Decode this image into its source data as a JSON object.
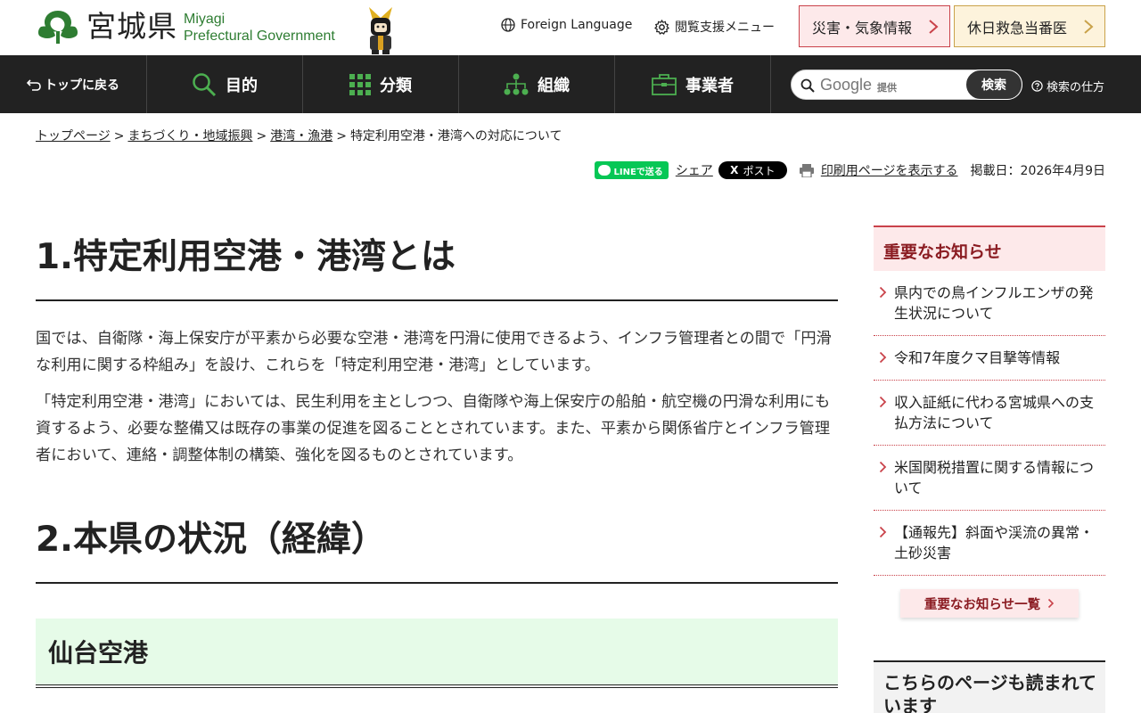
{
  "header": {
    "logo_ja": "宮城県",
    "logo_en_line1": "Miyagi",
    "logo_en_line2": "Prefectural Government",
    "foreign_language": "Foreign Language",
    "accessibility_menu": "閲覧支援メニュー",
    "disaster_button": "災害・気象情報",
    "holiday_button": "休日救急当番医"
  },
  "nav": {
    "back_to_top": "トップに戻る",
    "items": [
      {
        "label": "目的",
        "icon": "search-icon"
      },
      {
        "label": "分類",
        "icon": "grid-icon"
      },
      {
        "label": "組織",
        "icon": "org-chart-icon"
      },
      {
        "label": "事業者",
        "icon": "briefcase-icon"
      }
    ],
    "search_provider": "Google",
    "search_provider_suffix": "提供",
    "search_button": "検索",
    "search_help": "検索の仕方"
  },
  "breadcrumb": {
    "items": [
      "トップページ",
      "まちづくり・地域振興",
      "港湾・漁港"
    ],
    "current": "特定利用空港・港湾への対応について",
    "separator": ">"
  },
  "share": {
    "line": "LINEで送る",
    "facebook_share": "シェア",
    "x_post": "ポスト",
    "print": "印刷用ページを表示する",
    "posted_date": "掲載日：2026年4月9日"
  },
  "main": {
    "section1_heading": "1.特定利用空港・港湾とは",
    "section1_paragraph1": "国では、自衛隊・海上保安庁が平素から必要な空港・港湾を円滑に使用できるよう、インフラ管理者との間で「円滑な利用に関する枠組み」を設け、これらを「特定利用空港・港湾」としています。",
    "section1_paragraph2": "「特定利用空港・港湾」においては、民生利用を主としつつ、自衛隊や海上保安庁の船舶・航空機の円滑な利用にも資するよう、必要な整備又は既存の事業の促進を図ることとされています。また、平素から関係省庁とインフラ管理者において、連絡・調整体制の構築、強化を図るものとされています。",
    "section2_heading": "2.本県の状況（経緯）",
    "subsection_heading": "仙台空港"
  },
  "sidebar": {
    "important_heading": "重要なお知らせ",
    "important_items": [
      "県内での鳥インフルエンザの発生状況について",
      "令和7年度クマ目撃等情報",
      "収入証紙に代わる宮城県への支払方法について",
      "米国関税措置に関する情報について",
      "【通報先】斜面や渓流の異常・土砂災害"
    ],
    "important_more": "重要なお知らせ一覧",
    "also_read_heading": "こちらのページも読まれています"
  },
  "colors": {
    "nav_bg": "#222222",
    "brand_green": "#2e7d32",
    "alert_red": "#c9424a",
    "alert_text": "#8b1c22",
    "subheading_bg": "#e6fbe8"
  }
}
